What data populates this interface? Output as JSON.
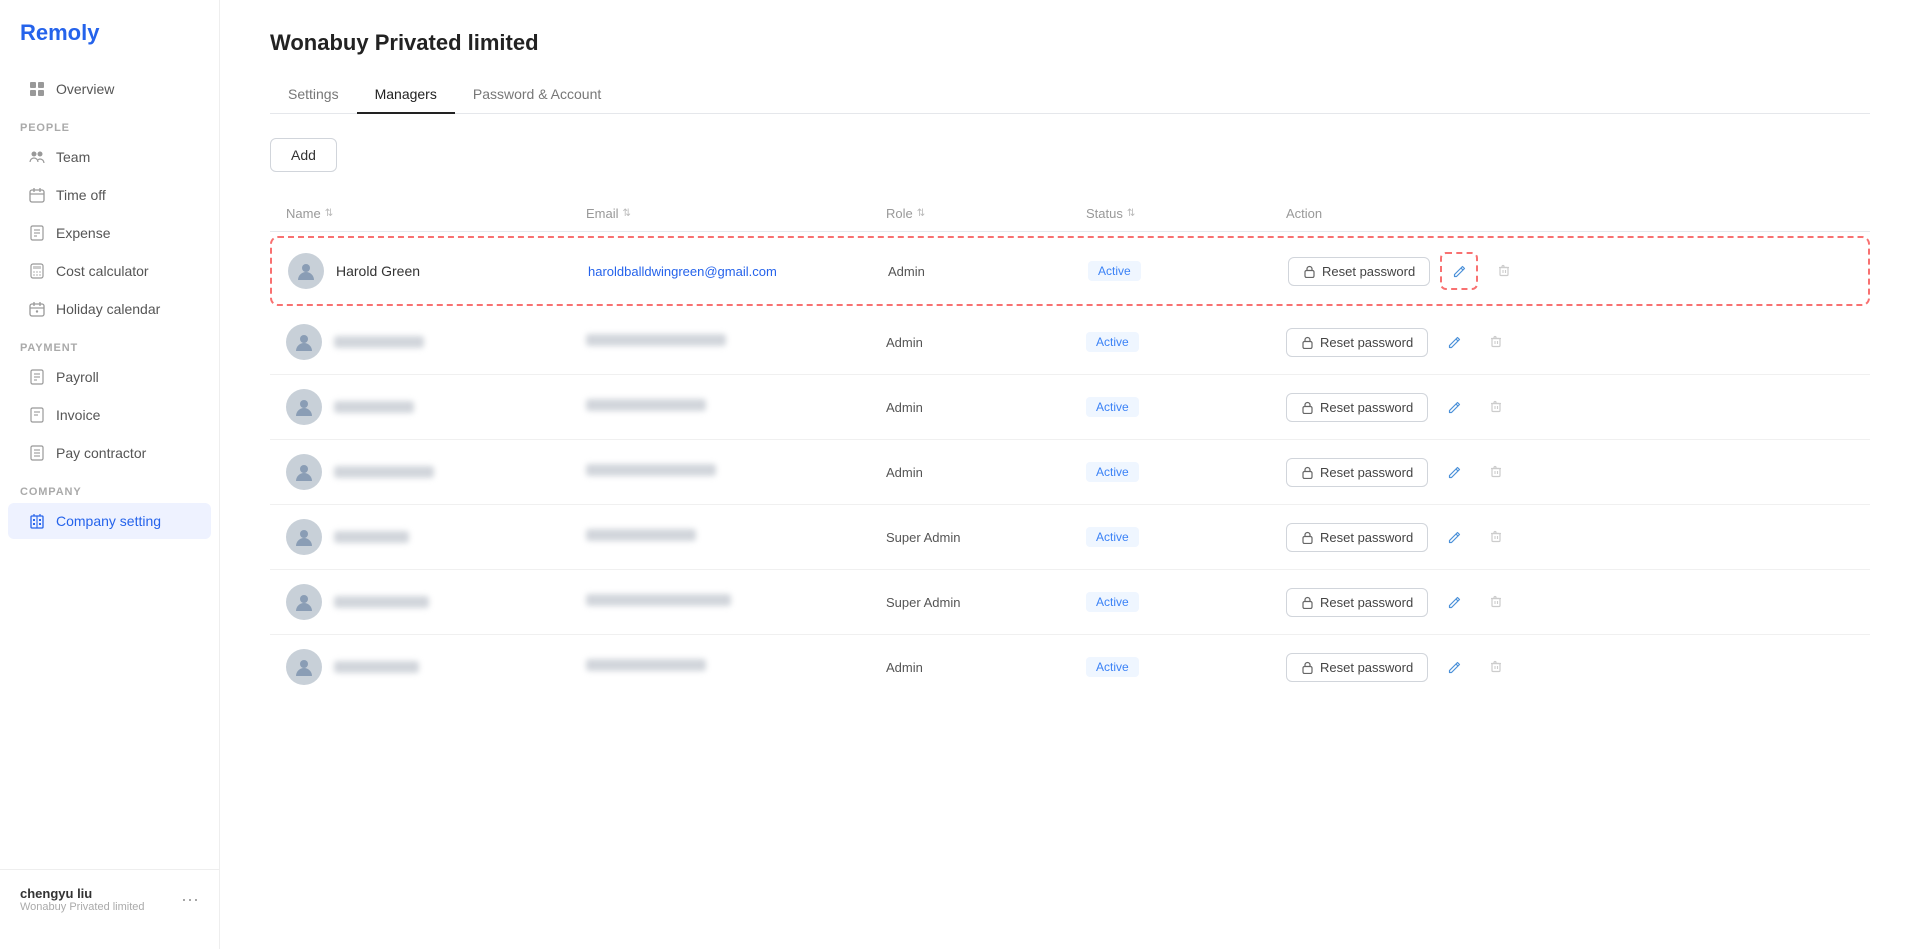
{
  "app": {
    "logo": "Remoly"
  },
  "sidebar": {
    "sections": [
      {
        "items": [
          {
            "id": "overview",
            "label": "Overview",
            "icon": "grid"
          }
        ]
      },
      {
        "label": "PEOPLE",
        "items": [
          {
            "id": "team",
            "label": "Team",
            "icon": "people"
          },
          {
            "id": "timeoff",
            "label": "Time off",
            "icon": "calendar"
          },
          {
            "id": "expense",
            "label": "Expense",
            "icon": "receipt"
          },
          {
            "id": "cost-calculator",
            "label": "Cost calculator",
            "icon": "calculator"
          },
          {
            "id": "holiday-calendar",
            "label": "Holiday calendar",
            "icon": "calendar2"
          }
        ]
      },
      {
        "label": "PAYMENT",
        "items": [
          {
            "id": "payroll",
            "label": "Payroll",
            "icon": "receipt2"
          },
          {
            "id": "invoice",
            "label": "Invoice",
            "icon": "invoice"
          },
          {
            "id": "pay-contractor",
            "label": "Pay contractor",
            "icon": "contractor"
          }
        ]
      },
      {
        "label": "COMPANY",
        "items": [
          {
            "id": "company-setting",
            "label": "Company setting",
            "icon": "building",
            "active": true
          }
        ]
      }
    ],
    "user": {
      "name": "chengyu liu",
      "company": "Wonabuy Privated limited"
    }
  },
  "page": {
    "title": "Wonabuy Privated limited",
    "tabs": [
      {
        "id": "settings",
        "label": "Settings"
      },
      {
        "id": "managers",
        "label": "Managers",
        "active": true
      },
      {
        "id": "password-account",
        "label": "Password & Account"
      }
    ],
    "add_button_label": "Add",
    "table": {
      "columns": [
        {
          "label": "Name",
          "sortable": true
        },
        {
          "label": "Email",
          "sortable": true
        },
        {
          "label": "Role",
          "sortable": true
        },
        {
          "label": "Status",
          "sortable": true
        },
        {
          "label": "Action",
          "sortable": false
        }
      ],
      "rows": [
        {
          "id": "row1",
          "name": "Harold Green",
          "email": "haroldballdwingreen@gmail.com",
          "role": "Admin",
          "status": "Active",
          "highlighted": true
        },
        {
          "id": "row2",
          "name": "",
          "email": "",
          "role": "Admin",
          "status": "Active",
          "blurred": true
        },
        {
          "id": "row3",
          "name": "",
          "email": "",
          "role": "Admin",
          "status": "Active",
          "blurred": true
        },
        {
          "id": "row4",
          "name": "",
          "email": "",
          "role": "Admin",
          "status": "Active",
          "blurred": true
        },
        {
          "id": "row5",
          "name": "",
          "email": "",
          "role": "Super Admin",
          "status": "Active",
          "blurred": true
        },
        {
          "id": "row6",
          "name": "",
          "email": "",
          "role": "Super Admin",
          "status": "Active",
          "blurred": true
        },
        {
          "id": "row7",
          "name": "",
          "email": "",
          "role": "Admin",
          "status": "Active",
          "blurred": true
        }
      ],
      "reset_password_label": "Reset password"
    }
  }
}
